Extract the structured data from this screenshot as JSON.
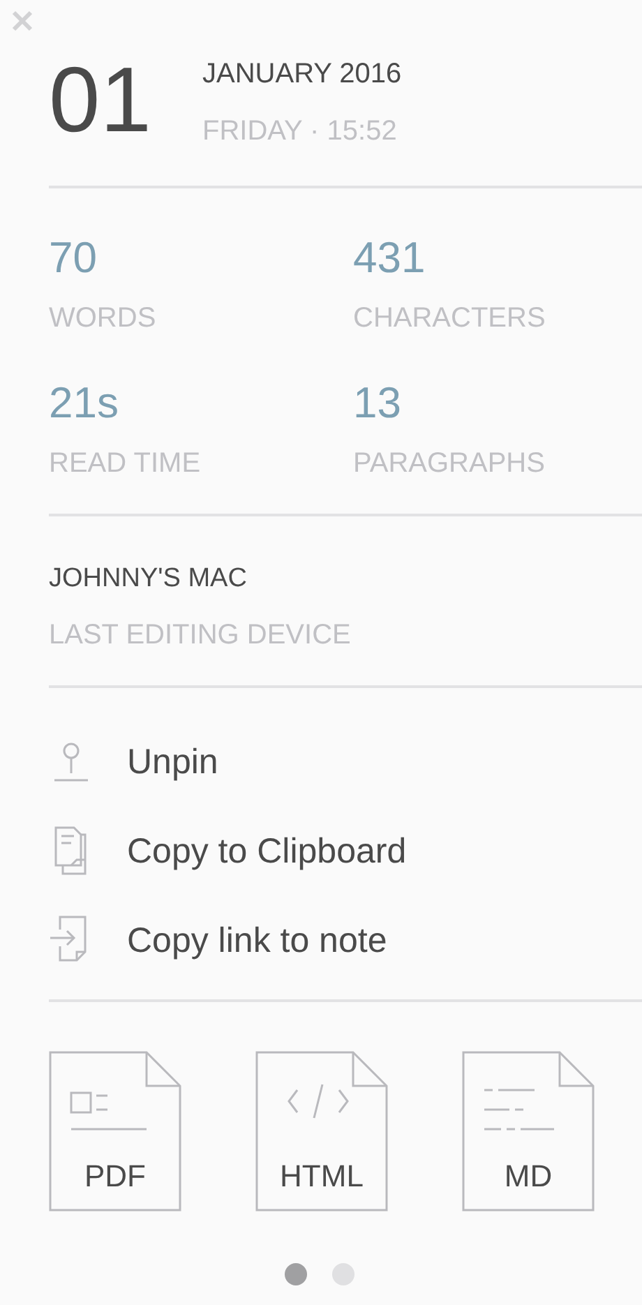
{
  "date": {
    "day": "01",
    "month_year": "JANUARY 2016",
    "weekday_time": "FRIDAY · 15:52"
  },
  "stats": [
    {
      "value": "70",
      "label": "WORDS"
    },
    {
      "value": "431",
      "label": "CHARACTERS"
    },
    {
      "value": "21s",
      "label": "READ TIME"
    },
    {
      "value": "13",
      "label": "PARAGRAPHS"
    }
  ],
  "device": {
    "name": "JOHNNY'S MAC",
    "caption": "LAST EDITING DEVICE"
  },
  "actions": [
    {
      "kind": "unpin",
      "label": "Unpin"
    },
    {
      "kind": "clipboard",
      "label": "Copy to Clipboard"
    },
    {
      "kind": "link",
      "label": "Copy link to note"
    }
  ],
  "exports": [
    {
      "kind": "pdf",
      "label": "PDF"
    },
    {
      "kind": "html",
      "label": "HTML"
    },
    {
      "kind": "md",
      "label": "MD"
    }
  ],
  "pages": [
    {
      "selected": true
    },
    {
      "selected": false
    }
  ]
}
